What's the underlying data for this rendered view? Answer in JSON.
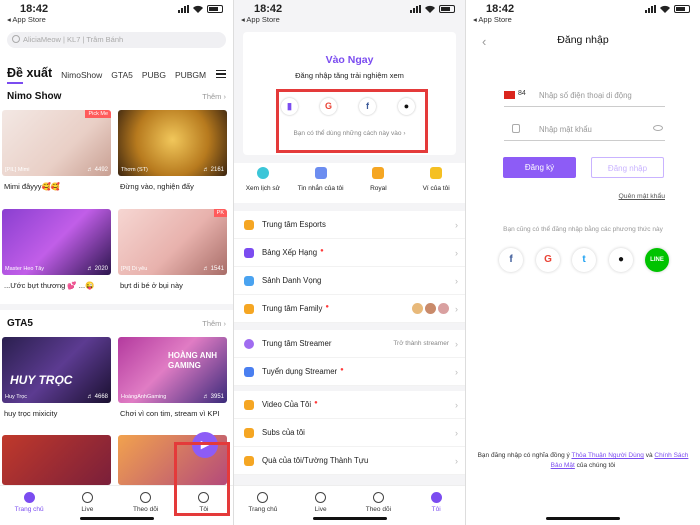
{
  "status": {
    "time": "18:42",
    "back_label": "◂ App Store"
  },
  "home": {
    "search_placeholder": "AliciaMeow | KL7 | Trâm Bánh",
    "tabs": [
      "Đề xuất",
      "NimoShow",
      "GTA5",
      "PUBG",
      "PUBGM"
    ],
    "sections": [
      {
        "title": "Nimo Show",
        "more": "Thêm ›",
        "items": [
          {
            "owner": "[PIL] Mimi",
            "count": "4492",
            "badge": "Pick Me",
            "caption": "Mimi đâyyy🥰🥰"
          },
          {
            "owner": "Thơm (ST)",
            "count": "2161",
            "badge": "",
            "caption": "Đừng vào, nghiện đấy"
          },
          {
            "owner": "Master Heo Tây",
            "count": "2020",
            "badge": "",
            "caption": "...Ước bựt thương 💕 ...😜"
          },
          {
            "owner": "[Pil] Di yêu",
            "count": "1541",
            "badge": "PK",
            "caption": "bựt di bé ở bụi này"
          }
        ]
      },
      {
        "title": "GTA5",
        "more": "Thêm ›",
        "items": [
          {
            "owner": "Huy Trọc",
            "count": "4668",
            "badge": "",
            "caption": "huy trọc mixicity"
          },
          {
            "owner": "HoàngAnhGaming",
            "count": "3951",
            "badge": "",
            "caption": "Chơi vì con tim, stream vì KPI"
          }
        ]
      }
    ],
    "thumb_text": {
      "huy": "HUY TRỌC",
      "hoang": "HOÀNG ANH GAMING"
    }
  },
  "nav": {
    "items": [
      "Trang chủ",
      "Live",
      "Theo dõi",
      "Tôi"
    ]
  },
  "profile": {
    "login_card": {
      "title": "Vào Ngay",
      "subtitle": "Đăng nhập tăng trải nghiệm xem",
      "other_ways": "Bạn có thể dùng những cách này vào ›"
    },
    "quick": [
      "Xem lịch sử",
      "Tin nhắn của tôi",
      "Royal",
      "Ví của tôi"
    ],
    "menu": [
      {
        "label": "Trung tâm Esports",
        "dot": false,
        "right": "",
        "color": "#f5a623"
      },
      {
        "label": "Bảng Xếp Hạng",
        "dot": true,
        "right": "",
        "color": "#7b4cf0"
      },
      {
        "label": "Sảnh Danh Vọng",
        "dot": false,
        "right": "",
        "color": "#4aa3f0"
      },
      {
        "label": "Trung tâm Family",
        "dot": true,
        "right": "",
        "color": "#f5a623"
      },
      {
        "label": "Trung tâm Streamer",
        "dot": false,
        "right": "Trở thành streamer",
        "color": "#a06cf0"
      },
      {
        "label": "Tuyển dụng Streamer",
        "dot": true,
        "right": "",
        "color": "#4a7ff0"
      },
      {
        "label": "Video Của Tôi",
        "dot": true,
        "right": "",
        "color": "#f5a623"
      },
      {
        "label": "Subs của tôi",
        "dot": false,
        "right": "",
        "color": "#f5a623"
      },
      {
        "label": "Quà của tôi/Tường Thành Tựu",
        "dot": false,
        "right": "",
        "color": "#f5a623"
      }
    ]
  },
  "login": {
    "title": "Đăng nhập",
    "country_code": "84",
    "phone_placeholder": "Nhập số điện thoại di động",
    "password_placeholder": "Nhập mật khẩu",
    "register_label": "Đăng ký",
    "login_label": "Đăng nhập",
    "forgot_label": "Quên mật khẩu",
    "alt_text": "Bạn cũng có thể đăng nhập bằng các phương thức này",
    "terms_prefix": "Bạn đăng nhập có nghĩa đồng ý",
    "terms_link1": "Thỏa Thuận Người Dùng",
    "terms_and": "và",
    "terms_link2": "Chính Sách Bảo Mật",
    "terms_suffix": "của chúng tôi"
  },
  "colors": {
    "accent": "#7b4cf0",
    "highlight": "#e43a3a"
  }
}
